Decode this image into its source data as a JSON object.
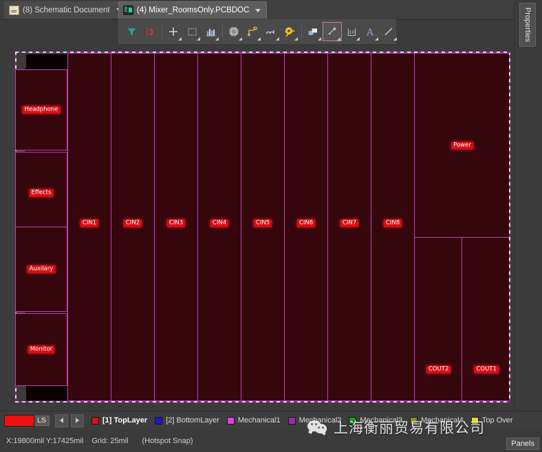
{
  "window": {
    "app": "PCB Editor"
  },
  "tabs": [
    {
      "label": "(8) Schematic Document",
      "icon": "schematic-document-icon",
      "active": false,
      "has_caret": true
    },
    {
      "label": "(4) Mixer_RoomsOnly.PCBDOC",
      "icon": "pcb-document-icon",
      "active": true,
      "has_caret": true
    }
  ],
  "toolbar": {
    "buttons": [
      {
        "name": "filter-icon",
        "tip": "Filter",
        "dropdown": false,
        "selected": false
      },
      {
        "name": "snap-magnet-icon",
        "tip": "Snapping",
        "dropdown": false,
        "selected": false
      },
      {
        "name": "crosshair-origin-icon",
        "tip": "Set Origin",
        "dropdown": true,
        "selected": false
      },
      {
        "name": "selection-rectangle-icon",
        "tip": "Select Area",
        "dropdown": true,
        "selected": false
      },
      {
        "name": "place-pad-array-icon",
        "tip": "Place Pad Array",
        "dropdown": true,
        "selected": false
      },
      {
        "name": "place-component-icon",
        "tip": "Place Component",
        "dropdown": true,
        "selected": false
      },
      {
        "name": "interactive-routing-icon",
        "tip": "Interactive Routing",
        "dropdown": true,
        "selected": false
      },
      {
        "name": "place-arc-icon",
        "tip": "Place Arc",
        "dropdown": true,
        "selected": false
      },
      {
        "name": "place-pad-icon",
        "tip": "Place Pad",
        "dropdown": true,
        "selected": false
      },
      {
        "name": "place-fill-icon",
        "tip": "Place Fill",
        "dropdown": true,
        "selected": false
      },
      {
        "name": "place-dimension-icon",
        "tip": "Place Dimension",
        "dropdown": true,
        "selected": true
      },
      {
        "name": "place-coordinate-icon",
        "tip": "Place Coordinate",
        "dropdown": true,
        "selected": false
      },
      {
        "name": "place-string-icon",
        "tip": "Place String",
        "dropdown": true,
        "selected": false
      },
      {
        "name": "place-line-icon",
        "tip": "Place Line",
        "dropdown": true,
        "selected": false
      }
    ]
  },
  "canvas": {
    "board_outline_color": "#c23fc2",
    "room_fill_color": "#35060c",
    "room_label_bg": "#d80d14",
    "rooms": [
      {
        "id": "headphone",
        "label": "Headphone"
      },
      {
        "id": "effects",
        "label": "Effects"
      },
      {
        "id": "auxilary",
        "label": "Auxilary"
      },
      {
        "id": "monitor",
        "label": "Monitor"
      },
      {
        "id": "cin1",
        "label": "CIN1"
      },
      {
        "id": "cin2",
        "label": "CIN2"
      },
      {
        "id": "cin3",
        "label": "CIN3"
      },
      {
        "id": "cin4",
        "label": "CIN4"
      },
      {
        "id": "cin5",
        "label": "CIN5"
      },
      {
        "id": "cin6",
        "label": "CIN6"
      },
      {
        "id": "cin7",
        "label": "CIN7"
      },
      {
        "id": "cin8",
        "label": "CIN8"
      },
      {
        "id": "power",
        "label": "Power"
      },
      {
        "id": "cout2",
        "label": "COUT2"
      },
      {
        "id": "cout1",
        "label": "COUT1"
      }
    ]
  },
  "layer_bar": {
    "active_color": "#ee1111",
    "ls_label": "LS",
    "prev_label": "",
    "next_label": "",
    "layers": [
      {
        "label": "[1] TopLayer",
        "color": "#d81111",
        "current": true
      },
      {
        "label": "[2] BottomLayer",
        "color": "#1616d8",
        "current": false
      },
      {
        "label": "Mechanical1",
        "color": "#e23ce2",
        "current": false
      },
      {
        "label": "Mechanical2",
        "color": "#9a2bb0",
        "current": false
      },
      {
        "label": "Mechanical3",
        "color": "#18a018",
        "current": false
      },
      {
        "label": "Mechanical4",
        "color": "#8a8a28",
        "current": false
      },
      {
        "label": "Top Over",
        "color": "#e0e020",
        "current": false
      }
    ]
  },
  "status_bar": {
    "coordinates": "X:19800mil Y:17425mil",
    "grid": "Grid: 25mil",
    "snap": "(Hotspot Snap)"
  },
  "right_panel": {
    "properties_tab": "Properties",
    "panels_button": "Panels"
  },
  "watermark": {
    "text": "上海衡丽贸易有限公司",
    "logo": "wechat-icon"
  }
}
